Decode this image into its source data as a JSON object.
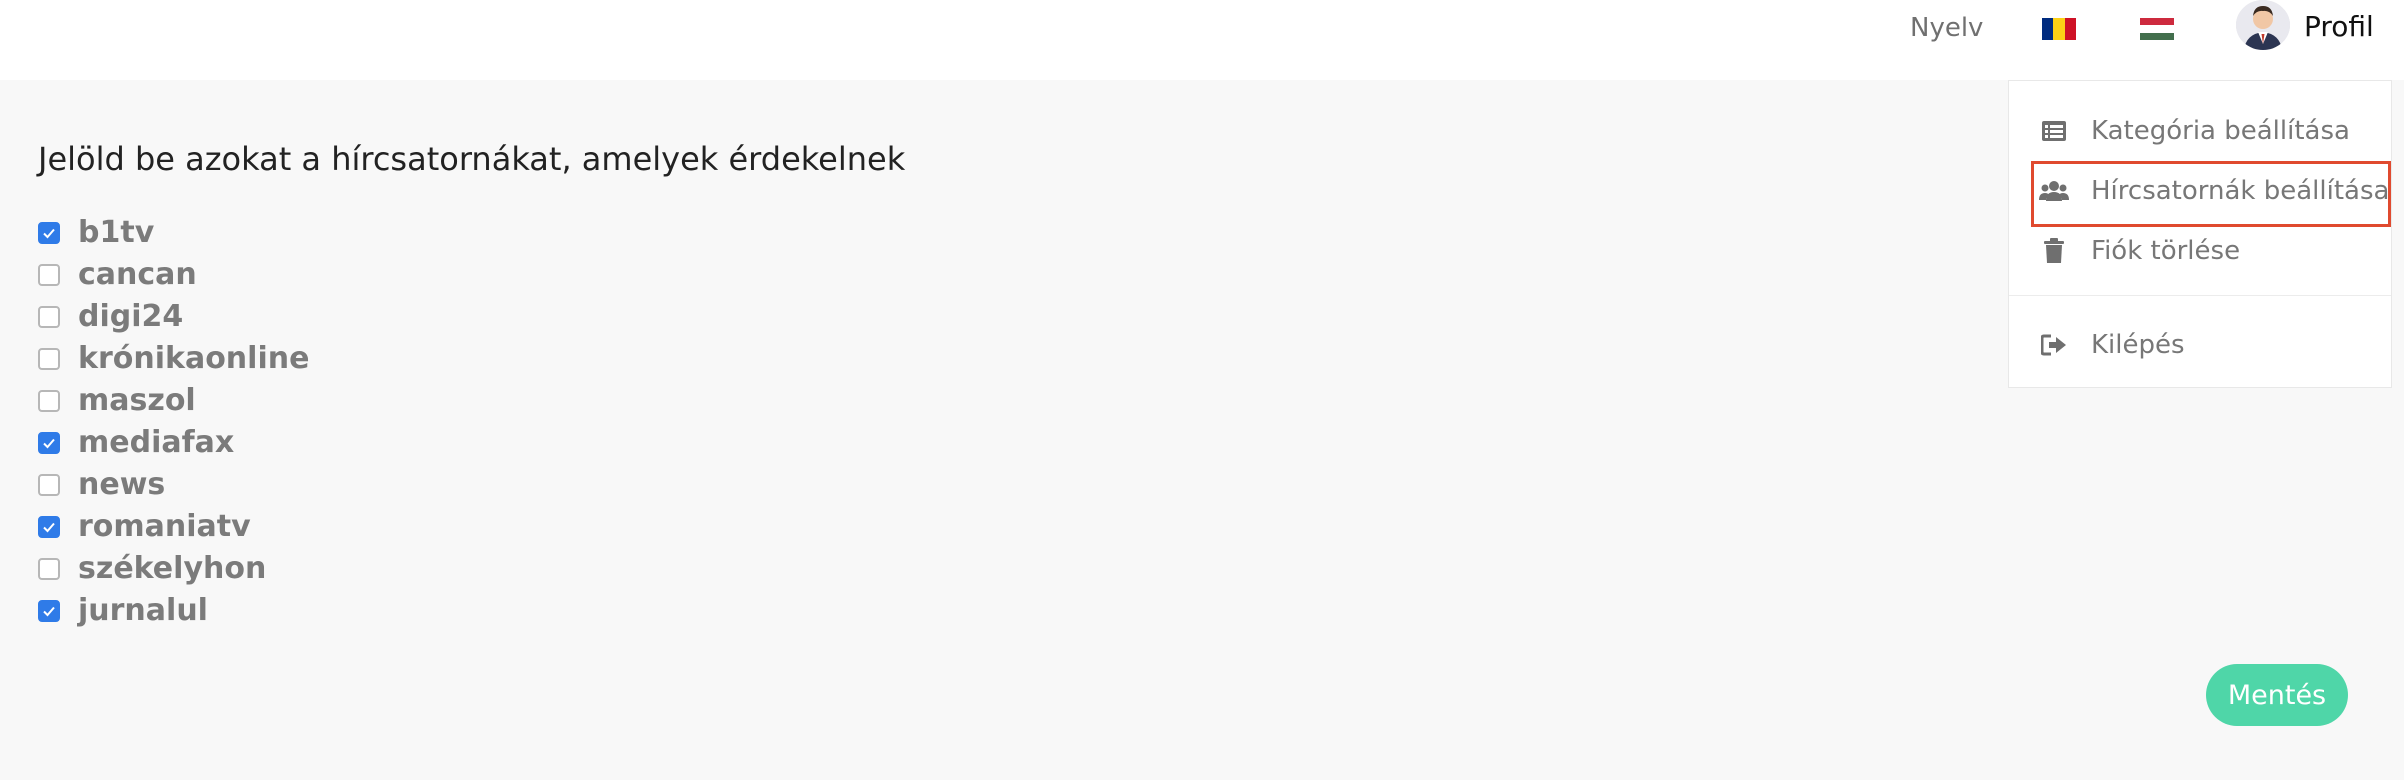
{
  "header": {
    "language_label": "Nyelv",
    "flags": [
      {
        "name": "romanian-flag",
        "colors": [
          "#002b7f",
          "#fcd116",
          "#ce1126"
        ]
      },
      {
        "name": "hungarian-flag",
        "colors": [
          "#cd2a3e",
          "#ffffff",
          "#436f4d"
        ]
      }
    ],
    "profile_label": "Profil"
  },
  "main": {
    "heading": "Jelöld be azokat a hírcsatornákat, amelyek érdekelnek",
    "channels": [
      {
        "label": "b1tv",
        "checked": true
      },
      {
        "label": "cancan",
        "checked": false
      },
      {
        "label": "digi24",
        "checked": false
      },
      {
        "label": "krónikaonline",
        "checked": false
      },
      {
        "label": "maszol",
        "checked": false
      },
      {
        "label": "mediafax",
        "checked": true
      },
      {
        "label": "news",
        "checked": false
      },
      {
        "label": "romaniatv",
        "checked": true
      },
      {
        "label": "székelyhon",
        "checked": false
      },
      {
        "label": "jurnalul",
        "checked": true
      }
    ],
    "save_label": "Mentés"
  },
  "profile_menu": {
    "items": [
      {
        "label": "Kategória beállítása",
        "icon": "list-icon"
      },
      {
        "label": "Hírcsatornák beállítása",
        "icon": "users-icon",
        "highlighted": true
      },
      {
        "label": "Fiók törlése",
        "icon": "trash-icon"
      },
      {
        "label": "Kilépés",
        "icon": "logout-icon"
      }
    ]
  },
  "colors": {
    "accent": "#2f7be8",
    "save_button": "#4fd6a8",
    "highlight_border": "#e04a2f"
  }
}
